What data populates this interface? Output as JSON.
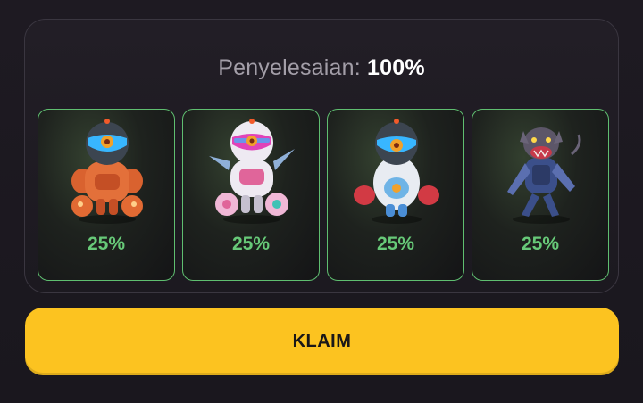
{
  "completion": {
    "label": "Penyelesaian:",
    "value": "100%"
  },
  "characters": [
    {
      "icon": "orange-diver-robot-icon",
      "percent": "25%"
    },
    {
      "icon": "pink-winged-robot-icon",
      "percent": "25%"
    },
    {
      "icon": "boxer-robot-icon",
      "percent": "25%"
    },
    {
      "icon": "armored-rat-icon",
      "percent": "25%"
    }
  ],
  "claim_button": {
    "label": "KLAIM"
  },
  "colors": {
    "accent": "#fcc320",
    "card_border": "#5fbe70",
    "percent_text": "#67c978"
  }
}
